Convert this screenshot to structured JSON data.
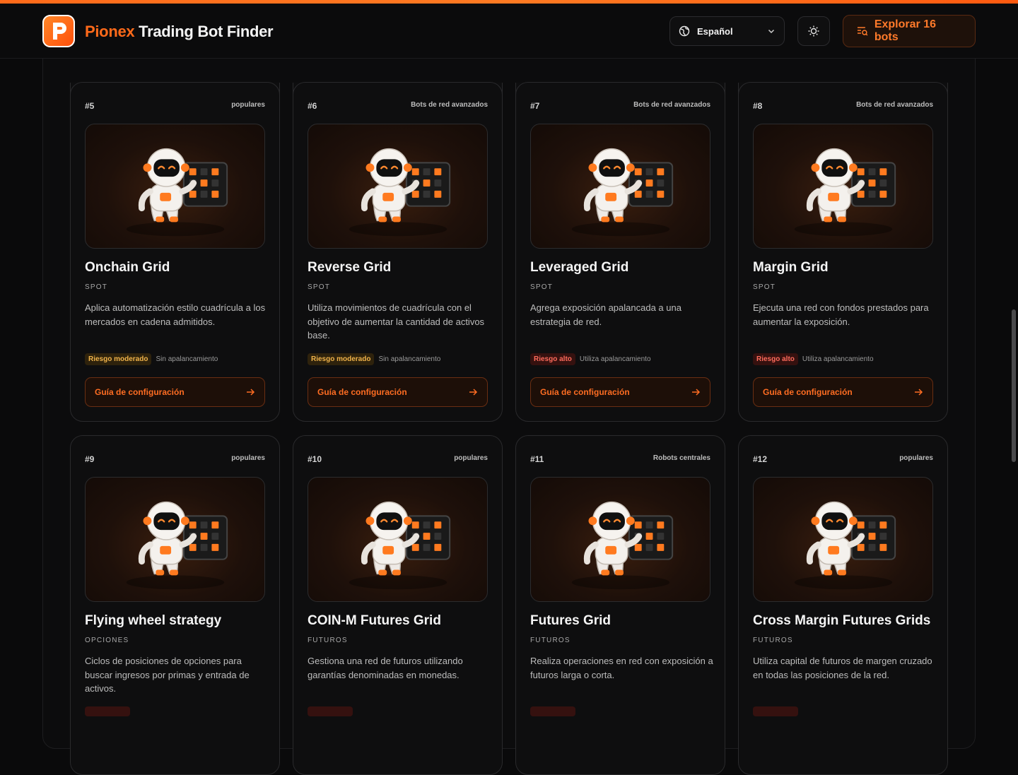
{
  "header": {
    "brand_a": "Pionex",
    "brand_b": "Trading Bot Finder",
    "language": "Español",
    "explore_label": "Explorar 16 bots",
    "icons": [
      "pionex-logo-icon",
      "globe-icon",
      "chevron-down-icon",
      "sun-icon",
      "search-list-icon"
    ]
  },
  "colors": {
    "accent": "#ff6a1a",
    "risk_moderate": "#f0b34a",
    "risk_high": "#ff6b5c"
  },
  "cards": [
    {
      "index": "#5",
      "category": "populares",
      "title": "Onchain Grid",
      "type": "SPOT",
      "description": "Aplica automatización estilo cuadrícula a los mercados en cadena admitidos.",
      "risk": "Riesgo moderado",
      "risk_level": "moderate",
      "leverage": "Sin apalancamiento",
      "guide": "Guía de configuración"
    },
    {
      "index": "#6",
      "category": "Bots de red avanzados",
      "title": "Reverse Grid",
      "type": "SPOT",
      "description": "Utiliza movimientos de cuadrícula con el objetivo de aumentar la cantidad de activos base.",
      "risk": "Riesgo moderado",
      "risk_level": "moderate",
      "leverage": "Sin apalancamiento",
      "guide": "Guía de configuración"
    },
    {
      "index": "#7",
      "category": "Bots de red avanzados",
      "title": "Leveraged Grid",
      "type": "SPOT",
      "description": "Agrega exposición apalancada a una estrategia de red.",
      "risk": "Riesgo alto",
      "risk_level": "high",
      "leverage": "Utiliza apalancamiento",
      "guide": "Guía de configuración"
    },
    {
      "index": "#8",
      "category": "Bots de red avanzados",
      "title": "Margin Grid",
      "type": "SPOT",
      "description": "Ejecuta una red con fondos prestados para aumentar la exposición.",
      "risk": "Riesgo alto",
      "risk_level": "high",
      "leverage": "Utiliza apalancamiento",
      "guide": "Guía de configuración"
    },
    {
      "index": "#9",
      "category": "populares",
      "title": "Flying wheel strategy",
      "type": "OPCIONES",
      "description": "Ciclos de posiciones de opciones para buscar ingresos por primas y entrada de activos.",
      "risk": "",
      "risk_level": "high",
      "leverage": "",
      "guide": ""
    },
    {
      "index": "#10",
      "category": "populares",
      "title": "COIN-M Futures Grid",
      "type": "FUTUROS",
      "description": "Gestiona una red de futuros utilizando garantías denominadas en monedas.",
      "risk": "",
      "risk_level": "high",
      "leverage": "",
      "guide": ""
    },
    {
      "index": "#11",
      "category": "Robots centrales",
      "title": "Futures Grid",
      "type": "FUTUROS",
      "description": "Realiza operaciones en red con exposición a futuros larga o corta.",
      "risk": "",
      "risk_level": "high",
      "leverage": "",
      "guide": ""
    },
    {
      "index": "#12",
      "category": "populares",
      "title": "Cross Margin Futures Grids",
      "type": "FUTUROS",
      "description": "Utiliza capital de futuros de margen cruzado en todas las posiciones de la red.",
      "risk": "",
      "risk_level": "high",
      "leverage": "",
      "guide": ""
    }
  ]
}
